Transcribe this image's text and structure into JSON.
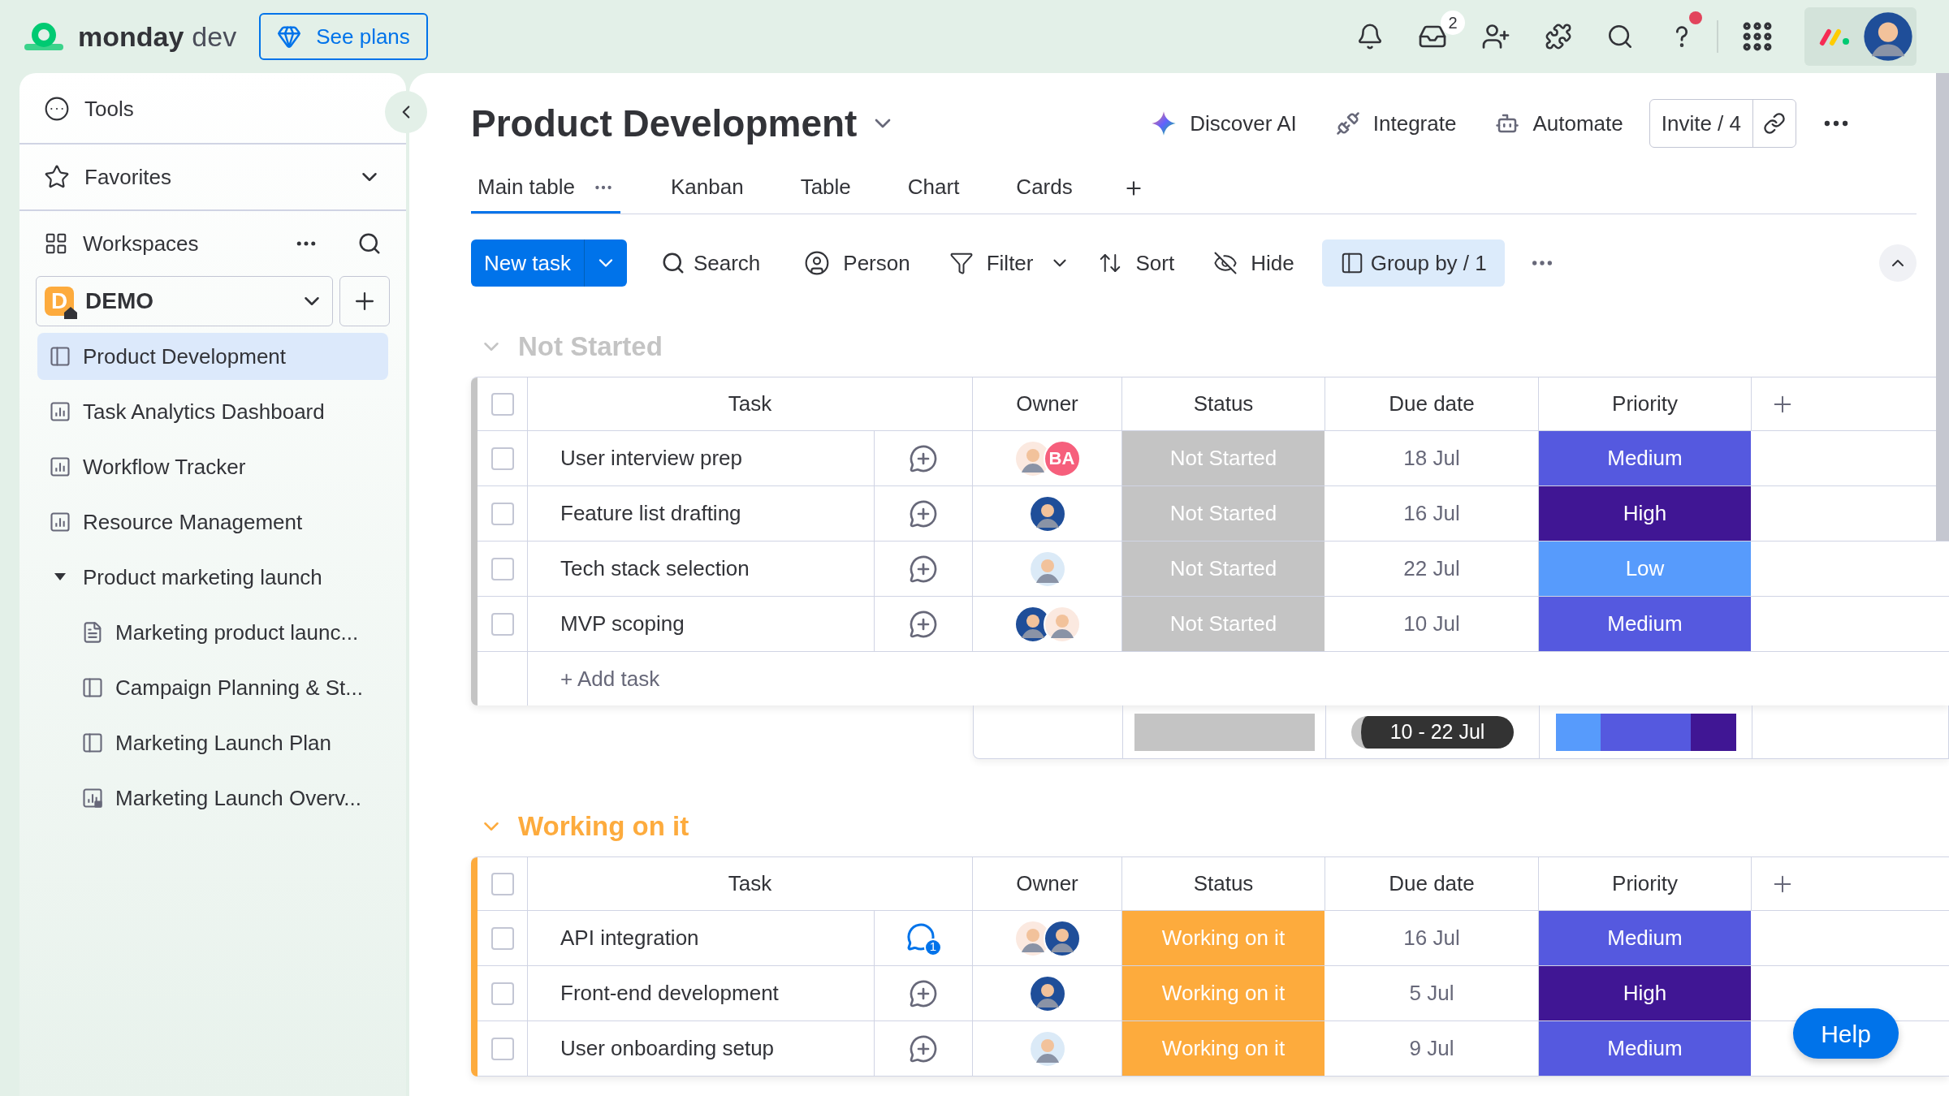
{
  "topbar": {
    "brand": "monday",
    "brand_suffix": "dev",
    "plans_button": "See plans",
    "inbox_badge": "2",
    "help_alert": true
  },
  "sidebar": {
    "tools": "Tools",
    "favorites": "Favorites",
    "workspaces": "Workspaces",
    "workspace": {
      "initial": "D",
      "name": "DEMO"
    },
    "items": [
      {
        "label": "Product Development",
        "kind": "board",
        "selected": true
      },
      {
        "label": "Task Analytics Dashboard",
        "kind": "dashboard",
        "selected": false
      },
      {
        "label": "Workflow Tracker",
        "kind": "dashboard",
        "selected": false
      },
      {
        "label": "Resource Management",
        "kind": "dashboard",
        "selected": false
      },
      {
        "label": "Product marketing launch",
        "kind": "folder",
        "selected": false,
        "expanded": true,
        "children": [
          {
            "label": "Marketing product launc...",
            "kind": "doc",
            "selected": false
          },
          {
            "label": "Campaign Planning & St...",
            "kind": "board",
            "selected": false
          },
          {
            "label": "Marketing Launch Plan",
            "kind": "board",
            "selected": false
          },
          {
            "label": "Marketing Launch Overv...",
            "kind": "dashboard_locked",
            "selected": false
          }
        ]
      }
    ]
  },
  "board": {
    "title": "Product Development",
    "actions": [
      "Discover AI",
      "Integrate",
      "Automate"
    ],
    "invite": "Invite / 4",
    "tabs": [
      {
        "label": "Main table",
        "selected": true
      },
      {
        "label": "Kanban",
        "selected": false
      },
      {
        "label": "Table",
        "selected": false
      },
      {
        "label": "Chart",
        "selected": false
      },
      {
        "label": "Cards",
        "selected": false
      }
    ],
    "toolbar": {
      "new_task": "New task",
      "search": "Search",
      "person": "Person",
      "filter": "Filter",
      "sort": "Sort",
      "hide": "Hide",
      "group_by": "Group by / 1"
    },
    "groups": [
      {
        "title": "Not Started",
        "color": "#c4c4c4",
        "all_checked": false,
        "columns": [
          "Task",
          "Owner",
          "Status",
          "Due date",
          "Priority"
        ],
        "rows": [
          {
            "checked": false,
            "task": "User interview prep",
            "owners": [
              {
                "kind": "figure",
                "color": "#fbe9e0"
              },
              {
                "kind": "initials",
                "text": "BA",
                "color": "#f65f7c"
              }
            ],
            "status": {
              "label": "Not Started",
              "color": "#c4c4c4"
            },
            "due": "18 Jul",
            "priority": {
              "label": "Medium",
              "color": "#5559df"
            }
          },
          {
            "checked": false,
            "task": "Feature list drafting",
            "owners": [
              {
                "kind": "figure",
                "color": "#1f4e99"
              }
            ],
            "status": {
              "label": "Not Started",
              "color": "#c4c4c4"
            },
            "due": "16 Jul",
            "priority": {
              "label": "High",
              "color": "#401694"
            }
          },
          {
            "checked": false,
            "task": "Tech stack selection",
            "owners": [
              {
                "kind": "figure",
                "color": "#dbeaf7"
              }
            ],
            "status": {
              "label": "Not Started",
              "color": "#c4c4c4"
            },
            "due": "22 Jul",
            "priority": {
              "label": "Low",
              "color": "#579bfc"
            }
          },
          {
            "checked": false,
            "task": "MVP scoping",
            "owners": [
              {
                "kind": "figure",
                "color": "#1f4e99"
              },
              {
                "kind": "figure",
                "color": "#fbe9e0"
              }
            ],
            "status": {
              "label": "Not Started",
              "color": "#c4c4c4"
            },
            "due": "10 Jul",
            "priority": {
              "label": "Medium",
              "color": "#5559df"
            }
          }
        ],
        "add_task": "+ Add task",
        "summary": {
          "status": [
            {
              "color": "#c4c4c4"
            }
          ],
          "dates": "10 - 22 Jul",
          "priority": [
            {
              "color": "#579bfc"
            },
            {
              "color": "#5559df"
            },
            {
              "color": "#401694"
            }
          ]
        }
      },
      {
        "title": "Working on it",
        "color": "#fdab3d",
        "all_checked": false,
        "columns": [
          "Task",
          "Owner",
          "Status",
          "Due date",
          "Priority"
        ],
        "rows": [
          {
            "checked": false,
            "task": "API integration",
            "comments": "1",
            "owners": [
              {
                "kind": "figure",
                "color": "#fbe9e0"
              },
              {
                "kind": "figure",
                "color": "#1f4e99"
              }
            ],
            "status": {
              "label": "Working on it",
              "color": "#fdab3d"
            },
            "due": "16 Jul",
            "priority": {
              "label": "Medium",
              "color": "#5559df"
            }
          },
          {
            "checked": false,
            "task": "Front-end development",
            "owners": [
              {
                "kind": "figure",
                "color": "#1f4e99"
              }
            ],
            "status": {
              "label": "Working on it",
              "color": "#fdab3d"
            },
            "due": "5 Jul",
            "priority": {
              "label": "High",
              "color": "#401694"
            }
          },
          {
            "checked": false,
            "task": "User onboarding setup",
            "owners": [
              {
                "kind": "figure",
                "color": "#dbeaf7"
              }
            ],
            "status": {
              "label": "Working on it",
              "color": "#fdab3d"
            },
            "due": "9 Jul",
            "priority": {
              "label": "Medium",
              "color": "#5559df"
            }
          }
        ]
      }
    ]
  },
  "help_button": "Help"
}
